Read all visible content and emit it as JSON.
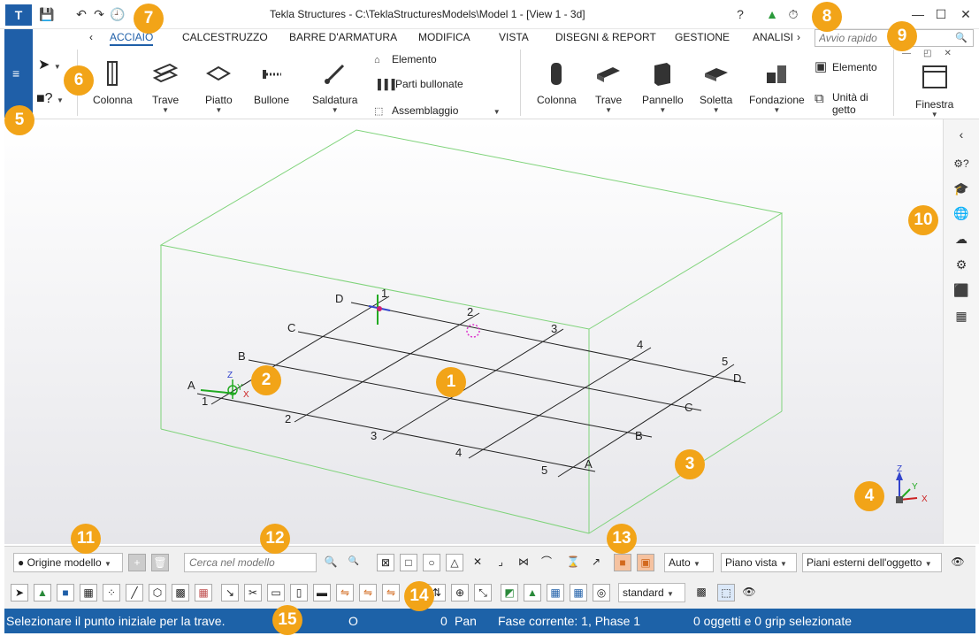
{
  "window": {
    "title": "Tekla Structures - C:\\TeklaStructuresModels\\Model 1  - [View 1 - 3d]",
    "app_logo": "T",
    "help_icon": "?",
    "user_icon": "▲",
    "timer_icon": "⏱",
    "minimize_icon": "—",
    "maximize_icon": "☐",
    "close_icon": "✕"
  },
  "quick_access": {
    "save_icon": "💾",
    "undo_icon": "↶",
    "redo_icon": "↷",
    "history_icon": "🕘"
  },
  "tabs": {
    "prev_icon": "‹",
    "next_icon": "›",
    "items": [
      "ACCIAIO",
      "CALCESTRUZZO",
      "BARRE D'ARMATURA",
      "MODIFICA",
      "VISTA",
      "DISEGNI & REPORT",
      "GESTIONE",
      "ANALISI"
    ],
    "active": "ACCIAIO"
  },
  "quick_launch": {
    "placeholder": "Avvio rapido",
    "search_icon": "🔍"
  },
  "side_menu": {
    "hamburger_icon": "≡",
    "select_icon": "➤",
    "help_icon": "?"
  },
  "ribbon": {
    "steel": {
      "column": "Colonna",
      "beam": "Trave",
      "plate": "Piatto",
      "bolt": "Bullone",
      "weld": "Saldatura",
      "element": "Elemento",
      "bolted_parts": "Parti bullonate",
      "assembly": "Assemblaggio"
    },
    "concrete": {
      "column": "Colonna",
      "beam": "Trave",
      "panel": "Pannello",
      "slab": "Soletta",
      "foundation": "Fondazione",
      "element": "Elemento",
      "pour_unit": "Unità di getto"
    },
    "window": "Finestra"
  },
  "badges": [
    "1",
    "2",
    "3",
    "4",
    "5",
    "6",
    "7",
    "8",
    "9",
    "10",
    "11",
    "12",
    "13",
    "14",
    "15"
  ],
  "grid": {
    "rows": [
      "A",
      "B",
      "C",
      "D"
    ],
    "columns": [
      "1",
      "2",
      "3",
      "4",
      "5"
    ],
    "axis": {
      "x": "X",
      "y": "Y",
      "z": "Z"
    }
  },
  "side_panel": {
    "icons": [
      "‹",
      "⚙?",
      "🎓",
      "🌐",
      "☁",
      "⚙",
      "⬛",
      "▦"
    ],
    "names": [
      "collapse-icon",
      "settings-help-icon",
      "learning-icon",
      "globe-icon",
      "cloud-icon",
      "gear-icon",
      "cube-icon",
      "shapes-icon"
    ]
  },
  "toolbar1": {
    "origin": "Origine modello",
    "add_icon": "+",
    "delete_icon": "🗑",
    "search_placeholder": "Cerca nel modello",
    "search_icon": "🔍",
    "search_options_icon": "🔍",
    "snap_icons": [
      "⊠",
      "□",
      "○",
      "△",
      "✕",
      "⌟",
      "⋈",
      "⌒",
      "⌛",
      "↗",
      "■",
      "▣"
    ],
    "auto": "Auto",
    "plane": "Piano vista",
    "planes": "Piani esterni dell'oggetto",
    "eye_icon": "👁"
  },
  "toolbar2": {
    "icons": [
      "➤",
      "▲",
      "■",
      "▦",
      "⁘",
      "╱",
      "⬡",
      "▩",
      "▦",
      "↘",
      "✂",
      "▭",
      "▯",
      "▬",
      "⇋",
      "⇋",
      "⇋",
      "⇅",
      "⊕",
      "⤡",
      "◩",
      "▲",
      "▦",
      "▦",
      "◎"
    ],
    "standard": "standard",
    "filter_icon": "▩",
    "select_icon": "⬚",
    "eye_icon": "👁"
  },
  "status": {
    "message": "Selezionare il punto iniziale per la trave.",
    "o": "O",
    "count": "0",
    "pan": "Pan",
    "phase": "Fase corrente: 1, Phase 1",
    "selection": "0 oggetti e 0 grip selezionate"
  },
  "colors": {
    "accent": "#1f5fa8",
    "badge": "#f2a418",
    "status_bar": "#1d62a8",
    "box_edges": "#6fcf6a"
  }
}
